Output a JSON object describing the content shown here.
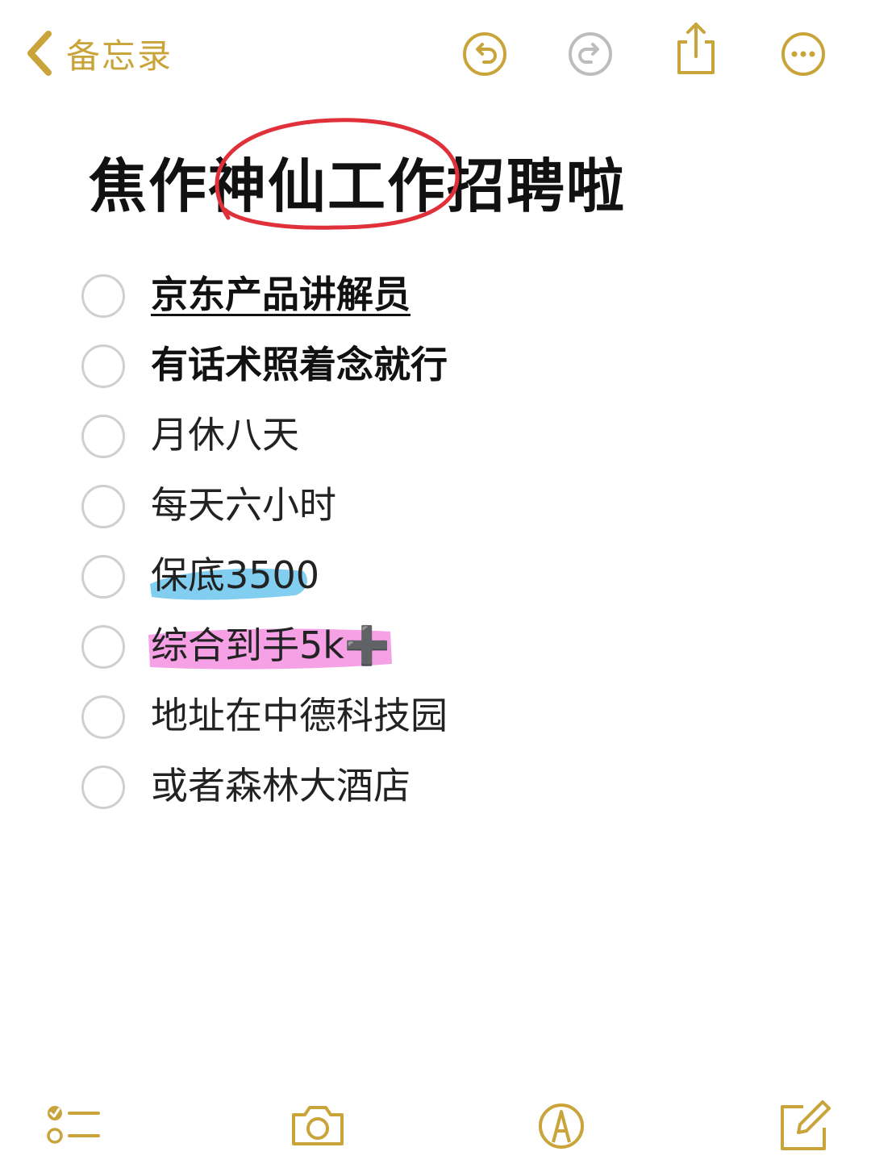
{
  "nav": {
    "back_label": "备忘录",
    "accent_color": "#c9a43a",
    "buttons": [
      "undo-icon",
      "redo-icon",
      "share-icon",
      "more-icon"
    ]
  },
  "note": {
    "title": "焦作神仙工作招聘啦",
    "checklist": [
      {
        "text": "京东产品讲解员",
        "checked": false
      },
      {
        "text": "有话术照着念就行",
        "checked": false
      },
      {
        "text": "月休八天",
        "checked": false
      },
      {
        "text": "每天六小时",
        "checked": false
      },
      {
        "text": "保底3500",
        "checked": false
      },
      {
        "text": "综合到手5k➕",
        "checked": false
      },
      {
        "text": "地址在中德科技园",
        "checked": false
      },
      {
        "text": "或者森林大酒店",
        "checked": false
      }
    ]
  },
  "toolbar": {
    "buttons": [
      "checklist-icon",
      "camera-icon",
      "markup-icon",
      "compose-icon"
    ]
  }
}
